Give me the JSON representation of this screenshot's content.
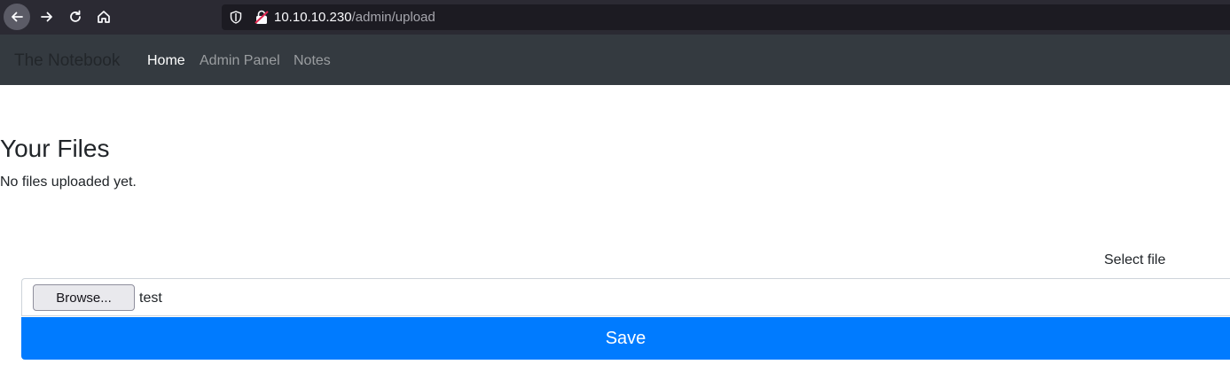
{
  "browser": {
    "url_host": "10.10.10.230",
    "url_path": "/admin/upload"
  },
  "navbar": {
    "brand": "The Notebook",
    "links": [
      {
        "label": "Home"
      },
      {
        "label": "Admin Panel"
      },
      {
        "label": "Notes"
      }
    ]
  },
  "main": {
    "title": "Your Files",
    "empty_message": "No files uploaded yet."
  },
  "upload": {
    "label": "Select file",
    "browse_label": "Browse...",
    "file_name": "test",
    "save_label": "Save"
  },
  "colors": {
    "navbar_bg": "#343a40",
    "primary": "#007bff"
  }
}
